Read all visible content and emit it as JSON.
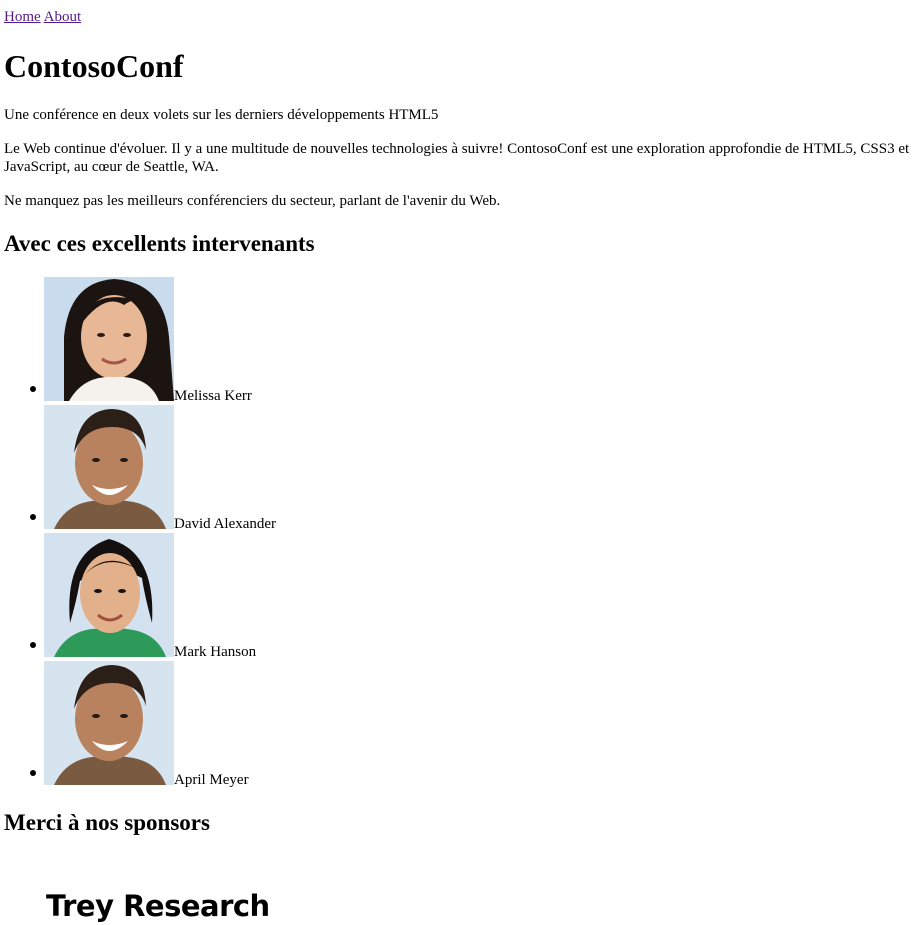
{
  "nav": {
    "home": "Home",
    "about": "About"
  },
  "title": "ContosoConf",
  "tagline": "Une conférence en deux volets sur les derniers développements HTML5",
  "intro": "Le Web continue d'évoluer. Il y a une multitude de nouvelles technologies à suivre! ContosoConf est une exploration approfondie de HTML5, CSS3 et JavaScript, au cœur de Seattle, WA.",
  "cta": "Ne manquez pas les meilleurs conférenciers du secteur, parlant de l'avenir du Web.",
  "speakers_heading": "Avec ces excellents intervenants",
  "speakers": [
    {
      "name": "Melissa Kerr"
    },
    {
      "name": "David Alexander"
    },
    {
      "name": "Mark Hanson"
    },
    {
      "name": "April Meyer"
    }
  ],
  "sponsors_heading": "Merci à nos sponsors",
  "sponsors": [
    {
      "name": "Trey Research"
    }
  ]
}
